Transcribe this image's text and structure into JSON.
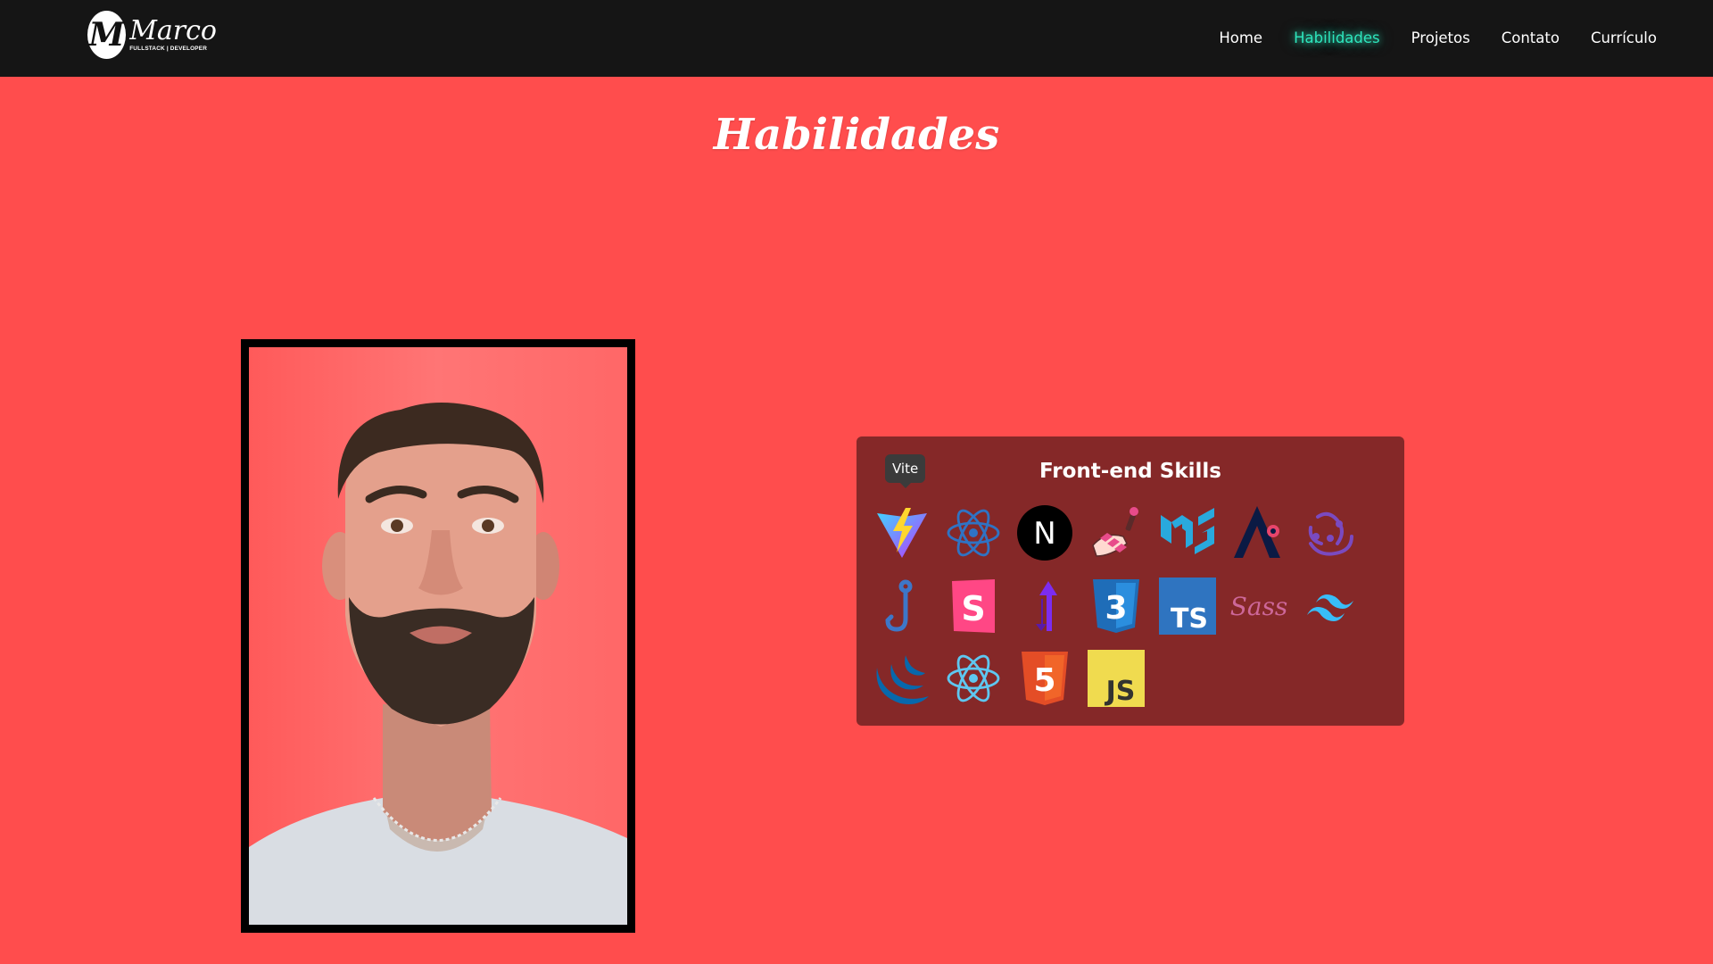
{
  "header": {
    "logo": {
      "letter": "M",
      "name": "Marco",
      "subtitle": "FULLSTACK | DEVELOPER"
    },
    "nav": [
      {
        "label": "Home",
        "active": false
      },
      {
        "label": "Habilidades",
        "active": true
      },
      {
        "label": "Projetos",
        "active": false
      },
      {
        "label": "Contato",
        "active": false
      },
      {
        "label": "Currículo",
        "active": false
      }
    ]
  },
  "main": {
    "title": "Habilidades",
    "skills_card": {
      "title": "Front-end Skills",
      "tooltip": "Vite",
      "icons": [
        {
          "name": "vite",
          "icon": "vite-icon",
          "label": ""
        },
        {
          "name": "react",
          "icon": "react-icon",
          "label": ""
        },
        {
          "name": "nextjs",
          "icon": "nextjs-icon",
          "label": "N"
        },
        {
          "name": "nail-polish",
          "icon": "nail-polish-icon",
          "label": ""
        },
        {
          "name": "material-ui",
          "icon": "material-ui-icon",
          "label": ""
        },
        {
          "name": "ant-design",
          "icon": "ant-design-icon",
          "label": ""
        },
        {
          "name": "redux",
          "icon": "redux-icon",
          "label": ""
        },
        {
          "name": "react-hook-form",
          "icon": "hook-icon",
          "label": ""
        },
        {
          "name": "storybook",
          "icon": "storybook-icon",
          "label": "S"
        },
        {
          "name": "styled-components",
          "icon": "styled-components-icon",
          "label": ""
        },
        {
          "name": "css3",
          "icon": "css3-icon",
          "label": "3"
        },
        {
          "name": "typescript",
          "icon": "typescript-icon",
          "label": "TS"
        },
        {
          "name": "sass",
          "icon": "sass-icon",
          "label": "Sass"
        },
        {
          "name": "tailwind",
          "icon": "tailwind-icon",
          "label": ""
        },
        {
          "name": "jquery",
          "icon": "jquery-icon",
          "label": ""
        },
        {
          "name": "react-native",
          "icon": "react-native-icon",
          "label": ""
        },
        {
          "name": "html5",
          "icon": "html5-icon",
          "label": "5"
        },
        {
          "name": "javascript",
          "icon": "javascript-icon",
          "label": "JS"
        }
      ]
    }
  },
  "colors": {
    "page_background": "#ff4d4d",
    "navbar_background": "#151515",
    "nav_active": "#2ee6bd",
    "card_background": "#852828",
    "tooltip_background": "#3b3b3b"
  }
}
